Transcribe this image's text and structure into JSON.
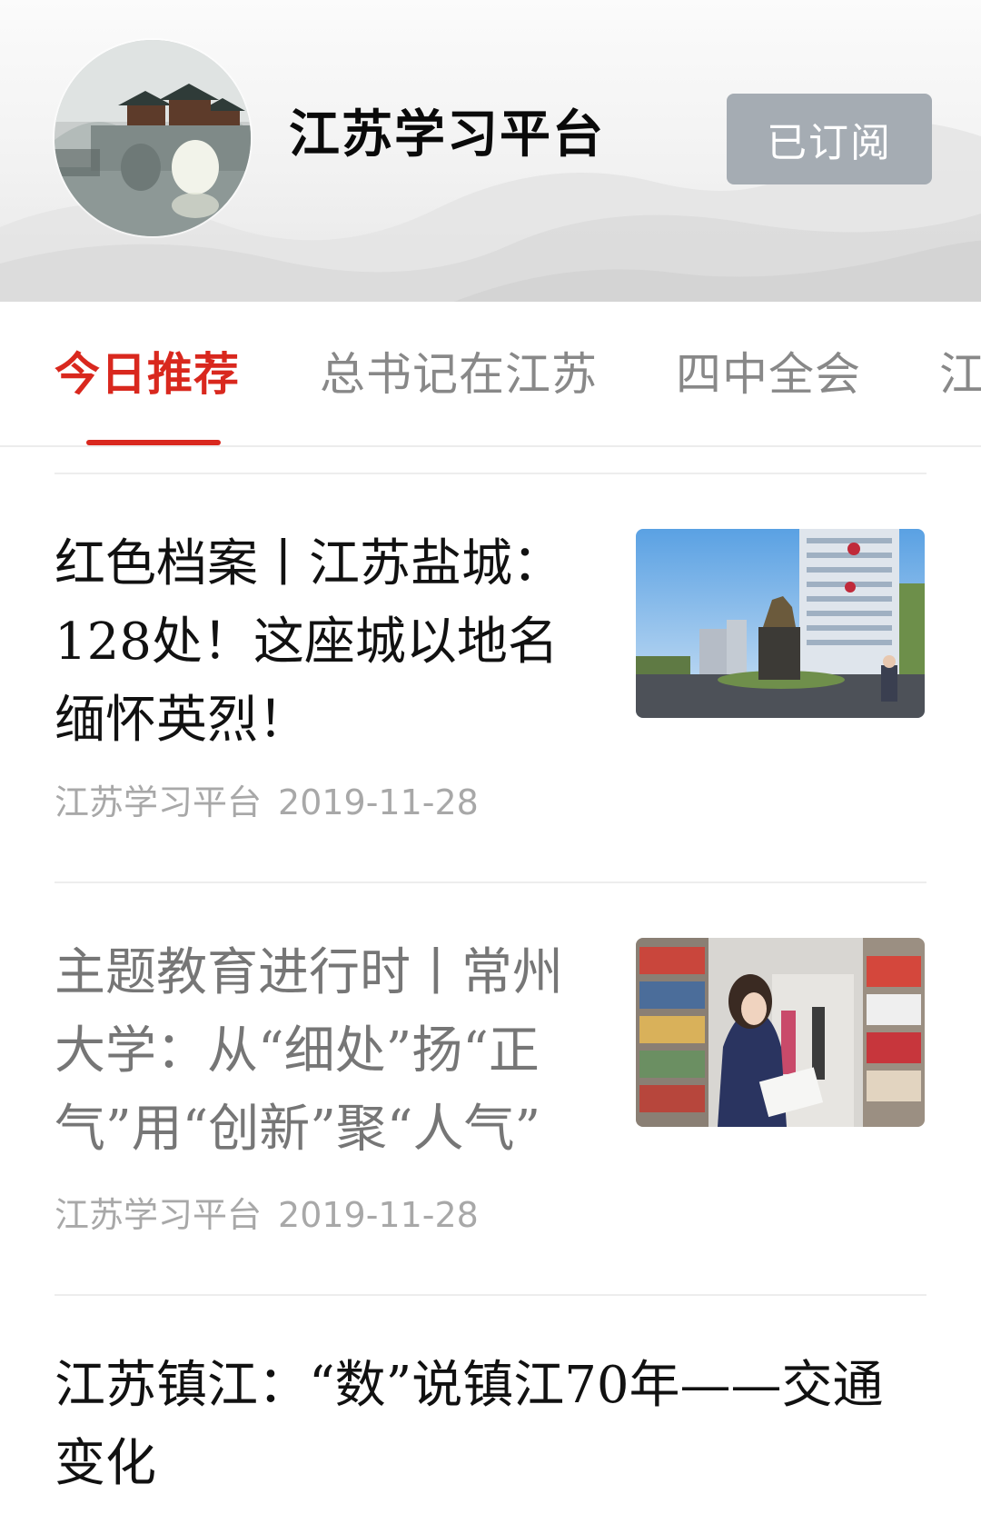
{
  "header": {
    "account_name": "江苏学习平台",
    "subscribe_label": "已订阅"
  },
  "tabs": [
    {
      "label": "今日推荐",
      "active": true
    },
    {
      "label": "总书记在江苏",
      "active": false
    },
    {
      "label": "四中全会",
      "active": false
    },
    {
      "label": "江",
      "active": false
    }
  ],
  "articles": [
    {
      "title": "红色档案丨江苏盐城：128处！这座城以地名缅怀英烈！",
      "source": "江苏学习平台",
      "date": "2019-11-28",
      "thumbnail_icon": "city-statue-image"
    },
    {
      "title": "主题教育进行时丨常州大学：从“细处”扬“正气”用“创新”聚“人气”",
      "source": "江苏学习平台",
      "date": "2019-11-28",
      "thumbnail_icon": "library-reading-image"
    },
    {
      "title": "江苏镇江：“数”说镇江70年——交通变化"
    }
  ],
  "colors": {
    "accent": "#d9281e",
    "subscribed_button": "#a5acb3",
    "meta_text": "#a8a8a8"
  }
}
